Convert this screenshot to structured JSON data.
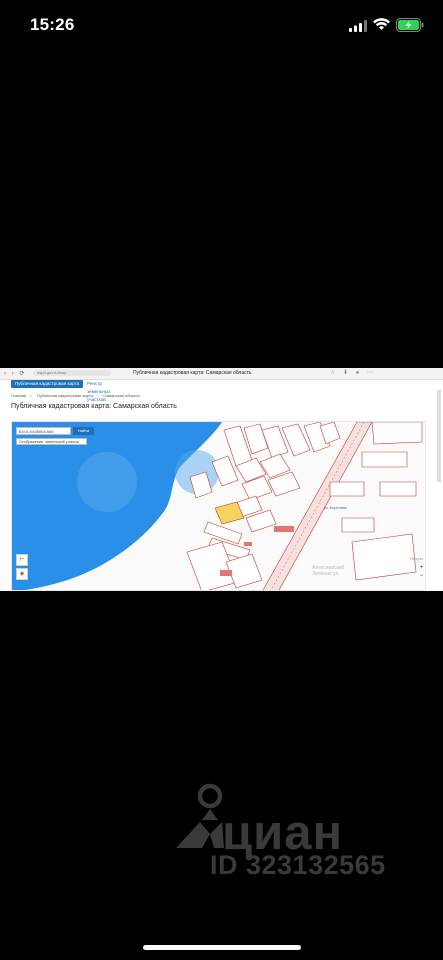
{
  "status_bar": {
    "time": "15:26",
    "battery_color": "#30d158"
  },
  "browser": {
    "url": "nspd.gov.ru/map",
    "page_title": "Публичная кадастровая карта: Самарская область"
  },
  "site": {
    "tab_active": "Публичная кадастровая карта",
    "tab_other": "Реестр земельных участков",
    "breadcrumbs": [
      "Главная",
      "Публичная кадастровая карта",
      "Самарская область"
    ],
    "heading": "Публичная кадастровая карта: Самарская область",
    "accent": "#1f6fb8"
  },
  "map": {
    "search_value": "63:01:0435004:565",
    "search_button": "Найти",
    "layer_select": "Отображение: земельный участок",
    "zoom_in": "+",
    "zoom_out": "−",
    "street_label": "ул. Береговая",
    "yandex": "Яндекс",
    "area_labels": [
      "Алексеевский",
      "Зелёная ул."
    ],
    "water_color": "#2a8fe8",
    "highlight_color": "#f4d35e",
    "parcel_stroke": "#c0392b"
  },
  "watermark": {
    "brand": "циан",
    "id_text": "ID 323132565"
  }
}
